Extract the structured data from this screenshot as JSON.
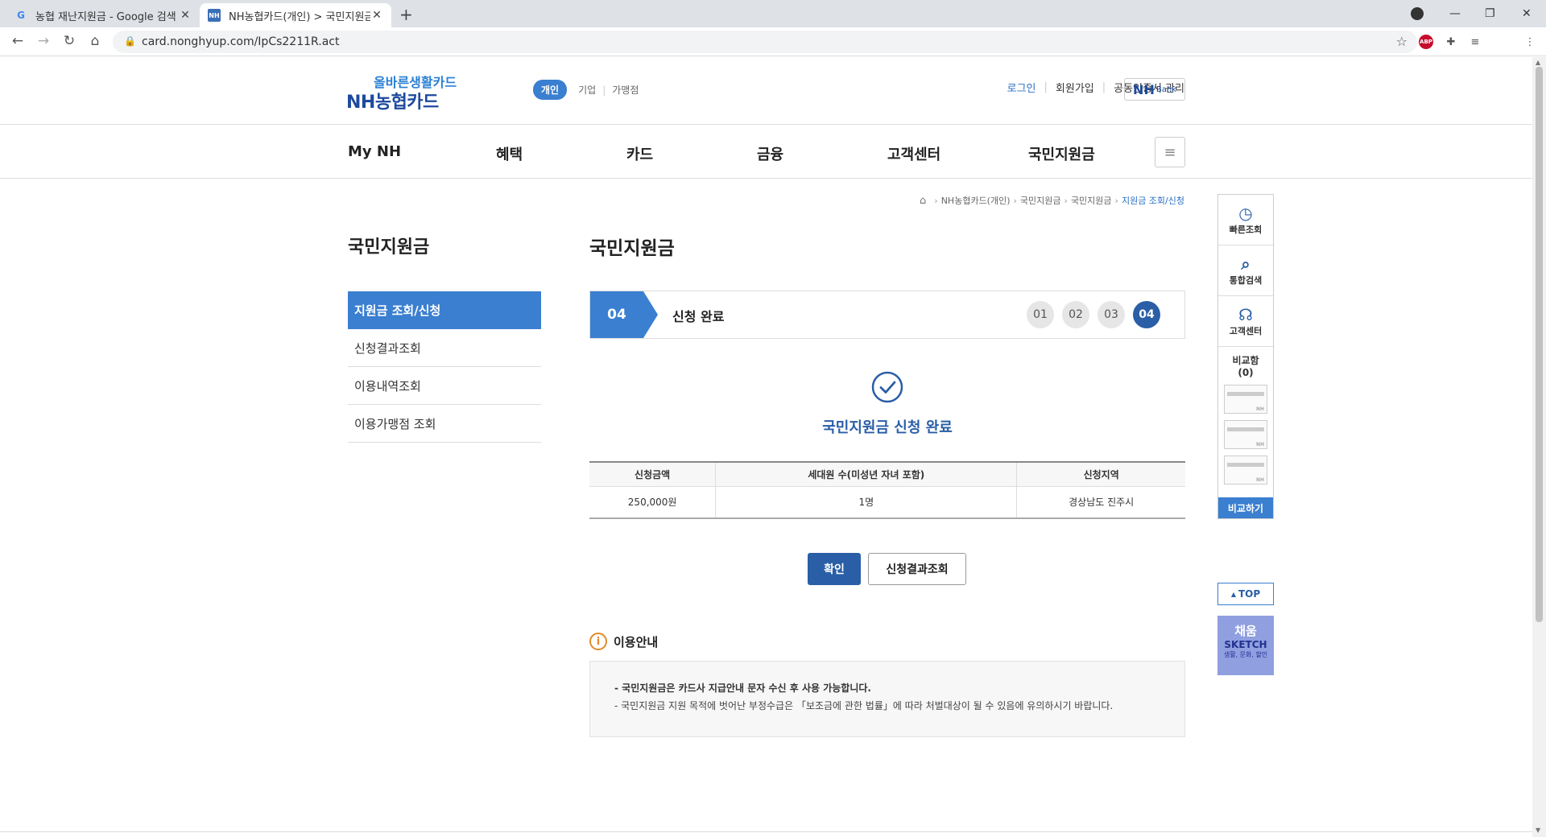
{
  "browser": {
    "tabs": [
      {
        "title": "농협 재난지원금 - Google 검색",
        "favicon": "google-icon"
      },
      {
        "title": "NH농협카드(개인) > 국민지원금",
        "favicon": "nh-icon"
      }
    ],
    "url": "card.nonghyup.com/IpCs2211R.act",
    "extensions": {
      "abp": "ABP"
    }
  },
  "header": {
    "logo_slogan": "올바른생활카드",
    "logo_brand": "NH농협카드",
    "segments": [
      "개인",
      "기업",
      "가맹점"
    ],
    "util": [
      "로그인",
      "회원가입",
      "공동인증서 관리"
    ],
    "nhbank": {
      "main": "NH",
      "sub": "Bank"
    }
  },
  "gnb": [
    "My NH",
    "혜택",
    "카드",
    "금융",
    "고객센터",
    "국민지원금"
  ],
  "breadcrumb": [
    "NH농협카드(개인)",
    "국민지원금",
    "국민지원금",
    "지원금 조회/신청"
  ],
  "lnb": {
    "title": "국민지원금",
    "items": [
      "지원금 조회/신청",
      "신청결과조회",
      "이용내역조회",
      "이용가맹점 조회"
    ]
  },
  "content": {
    "title": "국민지원금",
    "step": {
      "number": "04",
      "label": "신청 완료",
      "steps": [
        "01",
        "02",
        "03",
        "04"
      ],
      "current": "04"
    },
    "done_message": "국민지원금 신청 완료",
    "table": {
      "headers": [
        "신청금액",
        "세대원 수(미성년 자녀 포함)",
        "신청지역"
      ],
      "row": [
        "250,000원",
        "1명",
        "경상남도 진주시"
      ]
    },
    "buttons": {
      "ok": "확인",
      "result": "신청결과조회"
    },
    "notice": {
      "title": "이용안내",
      "lines": [
        "- 국민지원금은 카드사 지급안내 문자 수신 후 사용 가능합니다.",
        "- 국민지원금 지원 목적에 벗어난 부정수급은 「보조금에 관한 법률」에 따라 처벌대상이 될 수 있음에 유의하시기 바랍니다."
      ]
    }
  },
  "quick_menu": {
    "items": [
      "빠른조회",
      "통합검색",
      "고객센터"
    ],
    "compare_label": "비교함 (0)",
    "compare_button": "비교하기",
    "top": "TOP",
    "banner": {
      "line1": "채움",
      "line2": "SKETCH",
      "line3": "생활, 문화, 할인"
    }
  },
  "colors": {
    "accent": "#3a7fd0",
    "navy": "#2a5ea6",
    "orange": "#e48a2b"
  }
}
